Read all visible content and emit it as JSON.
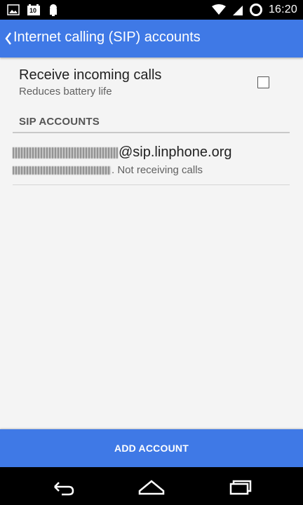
{
  "status_bar": {
    "time": "16:20",
    "left_icons": [
      "image-icon",
      "calendar-icon",
      "notification-lock-icon"
    ],
    "calendar_number": "10",
    "right_icons": [
      "wifi-icon",
      "signal-icon",
      "sync-circle-icon"
    ]
  },
  "app_bar": {
    "title": "Internet calling (SIP) accounts"
  },
  "preferences": {
    "incoming_calls": {
      "title": "Receive incoming calls",
      "summary": "Reduces battery life",
      "checked": false
    }
  },
  "section": {
    "header": "SIP ACCOUNTS"
  },
  "accounts": [
    {
      "title_suffix": "@sip.linphone.org",
      "summary_suffix": ". Not receiving calls"
    }
  ],
  "actions": {
    "add_account": "ADD ACCOUNT"
  },
  "colors": {
    "app_bar": "#3f79e6",
    "background": "#f4f4f4",
    "status_bar": "#000000"
  }
}
